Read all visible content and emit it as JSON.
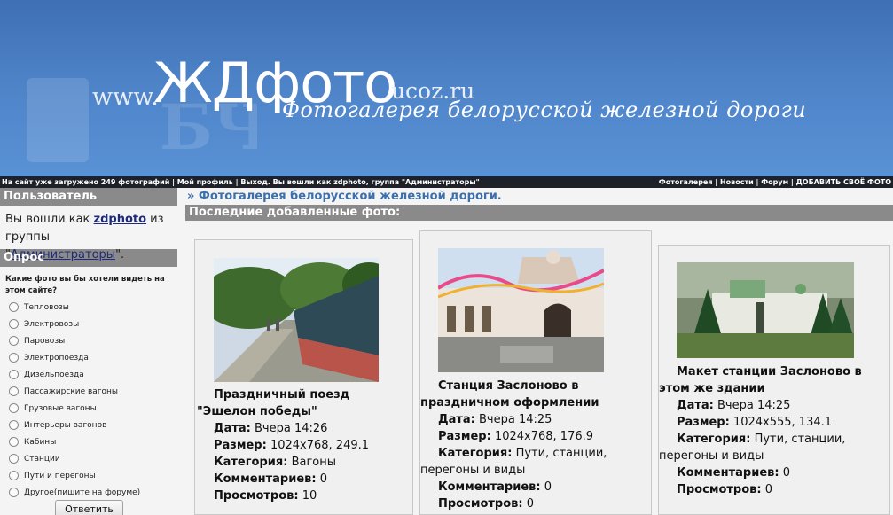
{
  "header": {
    "www": "www.",
    "title": "ЖДфото",
    "domain": ".ucoz.ru",
    "subtitle": "Фотогалерея белорусской железной дороги"
  },
  "topbar": {
    "left": "На сайт уже загружено 249 фотографий | Мой профиль | Выход.  Вы вошли как zdphoto, группа \"Администраторы\"",
    "links": [
      "Фотогалерея",
      "Новости",
      "Форум",
      "ДОБАВИТЬ СВОЁ ФОТО"
    ]
  },
  "sidebar": {
    "user_heading": "Пользователь",
    "logged_prefix": "Вы вошли как ",
    "username": "zdphoto",
    "from_group": " из группы \"",
    "group": "Администраторы",
    "group_suffix": "\".",
    "poll_heading": "Опрос",
    "poll_question": "Какие фото вы бы хотели видеть на этом сайте?",
    "poll_options": [
      "Тепловозы",
      "Электровозы",
      "Паровозы",
      "Электропоезда",
      "Дизельпоезда",
      "Пассажирские вагоны",
      "Грузовые вагоны",
      "Интерьеры вагонов",
      "Кабины",
      "Станции",
      "Пути и перегоны",
      "Другое(пишите на форуме)"
    ],
    "reply_button": "Ответить"
  },
  "main": {
    "breadcrumb": "» Фотогалерея белорусской железной дороги.",
    "section_heading": "Последние добавленные фото:",
    "labels": {
      "date": "Дата:",
      "size": "Размер:",
      "category": "Категория:",
      "comments": "Комментариев:",
      "views": "Просмотров:"
    },
    "photos": [
      {
        "title": "Праздничный поезд \"Эшелон победы\"",
        "date": "Вчера 14:26",
        "size": "1024x768, 249.1",
        "category": "Вагоны",
        "comments": "0",
        "views": "10"
      },
      {
        "title": "Станция Заслоново в праздничном оформлении",
        "date": "Вчера 14:25",
        "size": "1024x768, 176.9",
        "category": "Пути, станции, перегоны и виды",
        "comments": "0",
        "views": "0"
      },
      {
        "title": "Макет станции Заслоново в этом же здании",
        "date": "Вчера 14:25",
        "size": "1024x555, 134.1",
        "category": "Пути, станции, перегоны и виды",
        "comments": "0",
        "views": "0"
      }
    ]
  }
}
